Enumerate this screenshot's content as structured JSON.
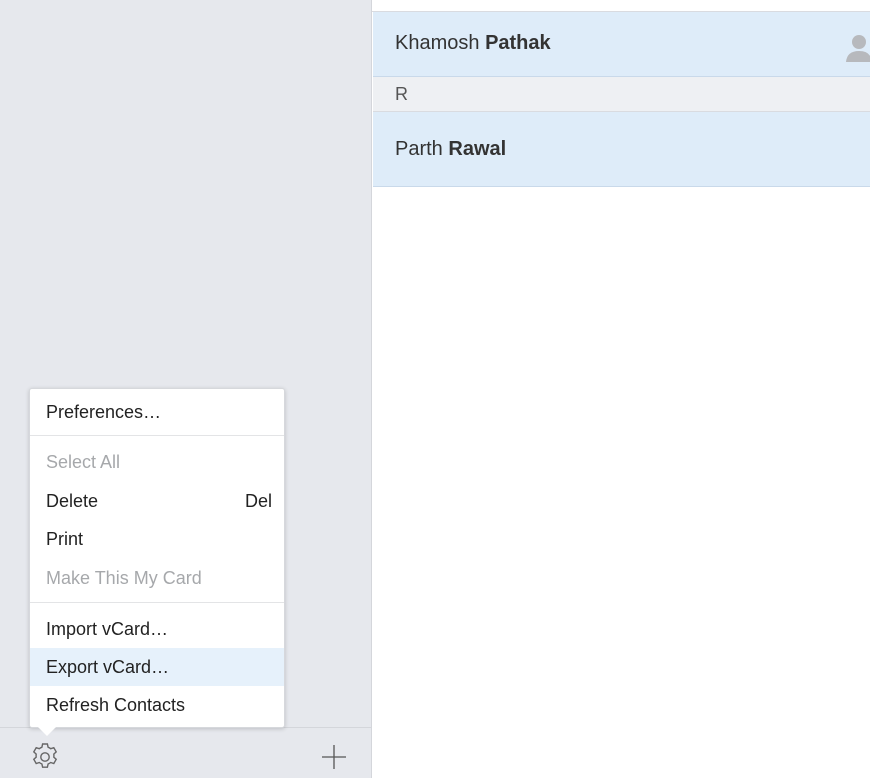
{
  "contacts": [
    {
      "first": "Khamosh",
      "last": "Pathak"
    },
    {
      "first": "Parth",
      "last": "Rawal"
    }
  ],
  "section_header": "R",
  "menu": {
    "items": [
      {
        "label": "Preferences…",
        "enabled": true
      },
      {
        "label": "Select All",
        "enabled": false
      },
      {
        "label": "Delete",
        "enabled": true,
        "shortcut": "Del"
      },
      {
        "label": "Print",
        "enabled": true
      },
      {
        "label": "Make This My Card",
        "enabled": false
      },
      {
        "label": "Import vCard…",
        "enabled": true
      },
      {
        "label": "Export vCard…",
        "enabled": true,
        "highlighted": true
      },
      {
        "label": "Refresh Contacts",
        "enabled": true
      }
    ]
  },
  "icons": {
    "settings": "gear-icon",
    "add": "plus-icon",
    "contact": "person-icon"
  },
  "colors": {
    "selection": "#deecf9",
    "menu_highlight": "#e6f1fb",
    "sidebar": "#e6e8ed"
  }
}
